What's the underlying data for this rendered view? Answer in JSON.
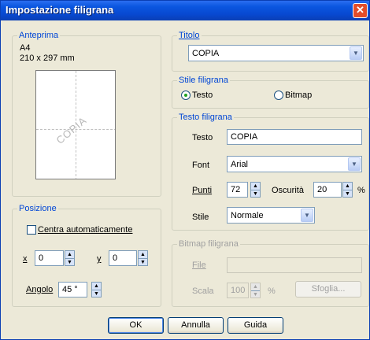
{
  "window": {
    "title": "Impostazione filigrana"
  },
  "preview": {
    "legend": "Anteprima",
    "paper_size": "A4",
    "paper_dims": "210 x 297 mm",
    "watermark_text": "COPIA"
  },
  "titolo": {
    "legend": "Titolo",
    "value": "COPIA"
  },
  "stile_filigrana": {
    "legend": "Stile filigrana",
    "option_text": "Testo",
    "option_bitmap": "Bitmap",
    "selected": "Testo"
  },
  "testo_filigrana": {
    "legend": "Testo filigrana",
    "testo_label": "Testo",
    "testo_value": "COPIA",
    "font_label": "Font",
    "font_value": "Arial",
    "punti_label": "Punti",
    "punti_value": "72",
    "oscurita_label": "Oscurità",
    "oscurita_value": "20",
    "percent": "%",
    "stile_label": "Stile",
    "stile_value": "Normale"
  },
  "posizione": {
    "legend": "Posizione",
    "center_label": "Centra automaticamente",
    "center_checked": false,
    "x_label": "x",
    "x_value": "0",
    "y_label": "y",
    "y_value": "0",
    "angolo_label": "Angolo",
    "angolo_value": "45 °"
  },
  "bitmap_filigrana": {
    "legend": "Bitmap filigrana",
    "file_label": "File",
    "file_value": "",
    "scala_label": "Scala",
    "scala_value": "100",
    "percent": "%",
    "browse_label": "Sfoglia..."
  },
  "footer": {
    "ok_label": "OK",
    "cancel_label": "Annulla",
    "help_label": "Guida"
  },
  "colors": {
    "titlebar": "#0a56e0",
    "face": "#ece9d8",
    "legend": "#0046d5"
  }
}
